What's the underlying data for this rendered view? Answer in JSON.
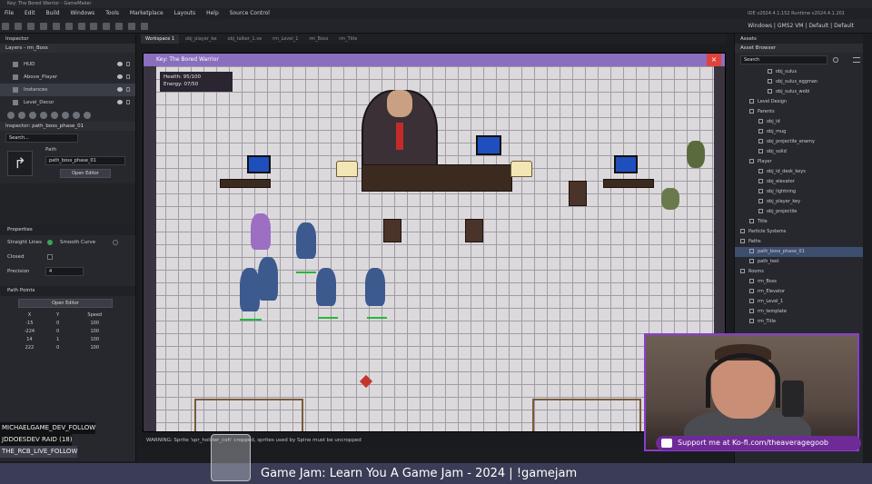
{
  "window": {
    "title": "Key: The Bored Warrior - GameMaker",
    "ide_info": "IDE v2024.4.1.152  Runtime v2024.4.1.201"
  },
  "menu": [
    "File",
    "Edit",
    "Build",
    "Windows",
    "Tools",
    "Marketplace",
    "Layouts",
    "Help",
    "Source Control"
  ],
  "target": "Windows | GMS2 VM | Default | Default",
  "inspector": {
    "tab": "Inspector",
    "layers_header": "Layers - rm_Boss",
    "layers": [
      {
        "label": "HUD"
      },
      {
        "label": "Above_Player"
      },
      {
        "label": "Instances"
      },
      {
        "label": "Level_Decor"
      }
    ],
    "path_header": "Inspector: path_boss_phase_01",
    "search_placeholder": "Search...",
    "path_label": "Path",
    "path_name": "path_boss_phase_01",
    "open_editor": "Open Editor",
    "properties": "Properties",
    "straight_lines": "Straight Lines",
    "smooth_curve": "Smooth Curve",
    "closed": "Closed",
    "precision_label": "Precision",
    "precision_value": "4",
    "path_points": "Path Points",
    "points_open_editor": "Open Editor",
    "columns": [
      "X",
      "Y",
      "Speed"
    ],
    "points": [
      [
        "-15",
        "0",
        "100"
      ],
      [
        "-224",
        "0",
        "100"
      ],
      [
        "14",
        "1",
        "100"
      ],
      [
        "222",
        "0",
        "100"
      ]
    ]
  },
  "chat": [
    "MICHAELGAME_DEV_FOLLOW",
    "JDDOESDEV  RAID (18)",
    "THE_RCB_LIVE_FOLLOW"
  ],
  "workspace_tabs": [
    "Workspace 1",
    "obj_player_be",
    "obj_talker_1.ve",
    "rm_Level_1",
    "rm_Boss",
    "rm_Title"
  ],
  "game": {
    "title": "Key: The Bored Warrior",
    "close": "×",
    "hud_health": "Health: 95/100",
    "hud_energy": "Energy: 07/50"
  },
  "console": "WARNING: Sprite 'spr_holster_coh' cropped, sprites used by Spine must be uncropped",
  "assets": {
    "tab": "Assets",
    "browser": "Asset Browser",
    "search_placeholder": "Search",
    "tree": [
      {
        "label": "obj_sulus",
        "indent": 3
      },
      {
        "label": "obj_sulus_eggman",
        "indent": 3
      },
      {
        "label": "obj_sulus_wobi",
        "indent": 3
      },
      {
        "label": "Level Design",
        "indent": 1
      },
      {
        "label": "Parents",
        "indent": 1
      },
      {
        "label": "obj_id",
        "indent": 2
      },
      {
        "label": "obj_mug",
        "indent": 2
      },
      {
        "label": "obj_projectile_enemy",
        "indent": 2
      },
      {
        "label": "obj_solid",
        "indent": 2
      },
      {
        "label": "Player",
        "indent": 1
      },
      {
        "label": "obj_id_desk_keys",
        "indent": 2
      },
      {
        "label": "obj_elevator",
        "indent": 2
      },
      {
        "label": "obj_lightning",
        "indent": 2
      },
      {
        "label": "obj_player_key",
        "indent": 2
      },
      {
        "label": "obj_projectile",
        "indent": 2
      },
      {
        "label": "Title",
        "indent": 1
      },
      {
        "label": "Particle Systems",
        "indent": 0
      },
      {
        "label": "Paths",
        "indent": 0
      },
      {
        "label": "path_boss_phase_01",
        "indent": 1,
        "selected": true
      },
      {
        "label": "path_test",
        "indent": 1
      },
      {
        "label": "Rooms",
        "indent": 0
      },
      {
        "label": "rm_Boss",
        "indent": 1
      },
      {
        "label": "rm_Elevator",
        "indent": 1
      },
      {
        "label": "rm_Level_1",
        "indent": 1
      },
      {
        "label": "rm_template",
        "indent": 1
      },
      {
        "label": "rm_Title",
        "indent": 1
      }
    ]
  },
  "kofi": "Support me at Ko-fi.com/theaveragegoob",
  "stream_title": "Game Jam: Learn You A Game Jam - 2024 | !gamejam",
  "colors": {
    "accent_purple": "#8b3bd1",
    "game_titlebar": "#8a6fbf",
    "close_red": "#e0433c",
    "selection_blue": "#3d4e6e"
  }
}
